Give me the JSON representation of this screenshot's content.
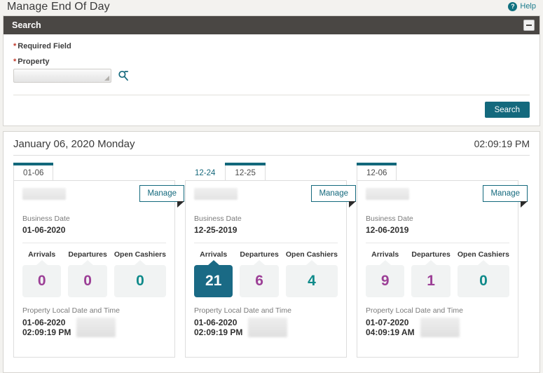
{
  "header": {
    "title": "Manage End Of Day",
    "help_label": "Help",
    "help_icon": "question-circle-icon"
  },
  "search_panel": {
    "title": "Search",
    "collapse_icon": "minimize-icon",
    "required_note": "Required Field",
    "property_label": "Property",
    "property_value": "",
    "property_placeholder": "",
    "lookup_icon": "search-icon",
    "search_button": "Search"
  },
  "results": {
    "date": "January 06, 2020 Monday",
    "time": "02:09:19 PM",
    "stat_labels": {
      "arrivals": "Arrivals",
      "departures": "Departures",
      "open_cashiers": "Open Cashiers"
    },
    "business_date_label": "Business Date",
    "local_datetime_label": "Property Local Date and Time",
    "manage_label": "Manage",
    "cards": [
      {
        "tabs": [
          {
            "label": "01-06",
            "active": true
          }
        ],
        "business_date": "01-06-2020",
        "arrivals": "0",
        "departures": "0",
        "open_cashiers": "0",
        "selected_stat": "",
        "local_date": "01-06-2020",
        "local_time": "02:09:19 PM"
      },
      {
        "tabs": [
          {
            "label": "12-24",
            "active": false
          },
          {
            "label": "12-25",
            "active": true
          }
        ],
        "business_date": "12-25-2019",
        "arrivals": "21",
        "departures": "6",
        "open_cashiers": "4",
        "selected_stat": "arrivals",
        "local_date": "01-06-2020",
        "local_time": "02:09:19 PM"
      },
      {
        "tabs": [
          {
            "label": "12-06",
            "active": true
          }
        ],
        "business_date": "12-06-2019",
        "arrivals": "9",
        "departures": "1",
        "open_cashiers": "0",
        "selected_stat": "",
        "local_date": "01-07-2020",
        "local_time": "04:09:19 AM"
      }
    ]
  },
  "colors": {
    "accent_teal": "#14697d",
    "selected_box": "#1a6a85",
    "number_purple": "#9c3f96",
    "number_teal": "#0f8a8a",
    "panel_header": "#4a4744"
  }
}
